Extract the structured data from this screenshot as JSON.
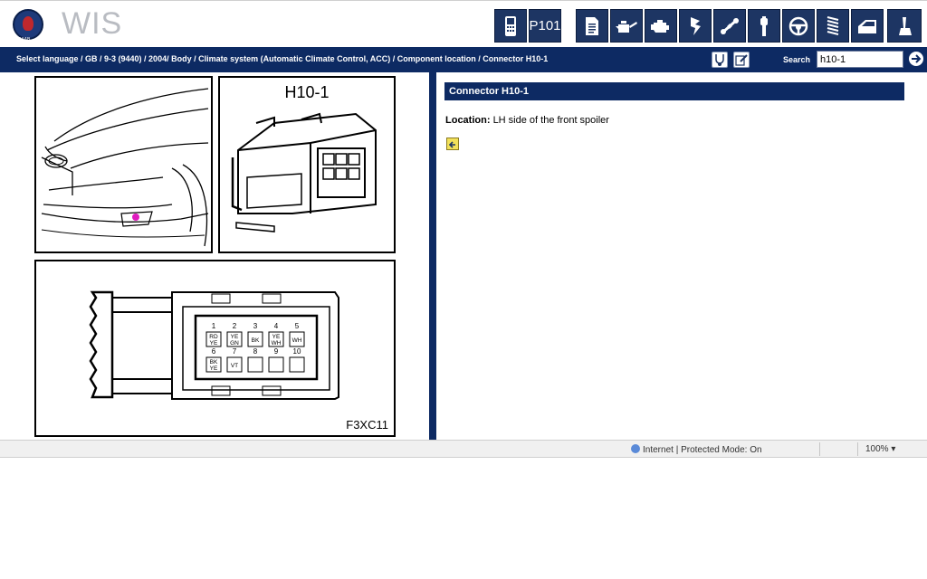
{
  "header": {
    "logo_caption": "SAAB",
    "app_name": "WIS",
    "toolbar": [
      {
        "name": "diagnostic-tester",
        "icon": "handheld-tester-icon"
      },
      {
        "name": "p101",
        "label": "P101"
      },
      {
        "name": "document",
        "icon": "document-icon"
      },
      {
        "name": "lubrication",
        "icon": "oil-can-icon"
      },
      {
        "name": "engine",
        "icon": "engine-icon"
      },
      {
        "name": "electrical",
        "icon": "lightning-icon"
      },
      {
        "name": "transmission",
        "icon": "driveshaft-icon"
      },
      {
        "name": "brakes",
        "icon": "brake-icon"
      },
      {
        "name": "steering",
        "icon": "steering-wheel-icon"
      },
      {
        "name": "suspension",
        "icon": "spring-icon"
      },
      {
        "name": "body",
        "icon": "car-door-icon"
      },
      {
        "name": "comfort",
        "icon": "seat-icon"
      }
    ]
  },
  "breadcrumb": "Select language / GB / 9-3 (9440) / 2004/ Body / Climate system (Automatic Climate Control, ACC) / Component location / Connector H10-1",
  "search": {
    "label": "Search",
    "value": "h10-1"
  },
  "figures": {
    "connector_label": "H10-1",
    "figure_code": "F3XC11",
    "pin_numbers": [
      "1",
      "2",
      "3",
      "4",
      "5",
      "6",
      "7",
      "8",
      "9",
      "10"
    ],
    "pin_wires": [
      "RD\nYE",
      "YE\nGN",
      "BK",
      "YE\nWH",
      "WH",
      "BK\nYE",
      "VT",
      "",
      "",
      ""
    ]
  },
  "content": {
    "title": "Connector H10-1",
    "location_label": "Location:",
    "location_value": "LH side of the front spoiler"
  },
  "status": {
    "zone": "Internet | Protected Mode: On",
    "zoom": "100%"
  },
  "colors": {
    "navy": "#0d2a63",
    "toolbar_button": "#1d3563",
    "highlight_pink": "#e01cbf"
  }
}
